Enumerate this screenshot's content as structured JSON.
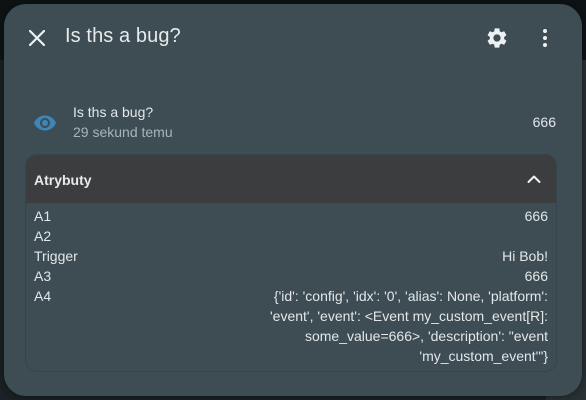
{
  "dialog": {
    "title": "Is ths a bug?",
    "icons": {
      "close": "close-icon",
      "settings": "gear-icon",
      "more": "more-vertical-icon"
    }
  },
  "entity": {
    "icon": "eye-icon",
    "name": "Is ths a bug?",
    "last_changed": "29 sekund temu",
    "state": "666"
  },
  "attributes": {
    "title": "Atrybuty",
    "expanded": true,
    "rows": [
      {
        "key": "A1",
        "value": "666"
      },
      {
        "key": "A2",
        "value": ""
      },
      {
        "key": "Trigger",
        "value": "Hi Bob!"
      },
      {
        "key": "A3",
        "value": "666"
      },
      {
        "key": "A4",
        "value": "{'id': 'config', 'idx': '0', 'alias': None, 'platform': 'event', 'event': <Event my_custom_event[R]: some_value=666>, 'description': \"event 'my_custom_event'\"}"
      }
    ]
  },
  "colors": {
    "dialog_bg": "#3d4d53",
    "attr_header_bg": "#3b3d3e",
    "eye_icon": "#3e86b9",
    "text_primary": "#e3e7e8",
    "text_secondary": "#a9b4b7"
  }
}
